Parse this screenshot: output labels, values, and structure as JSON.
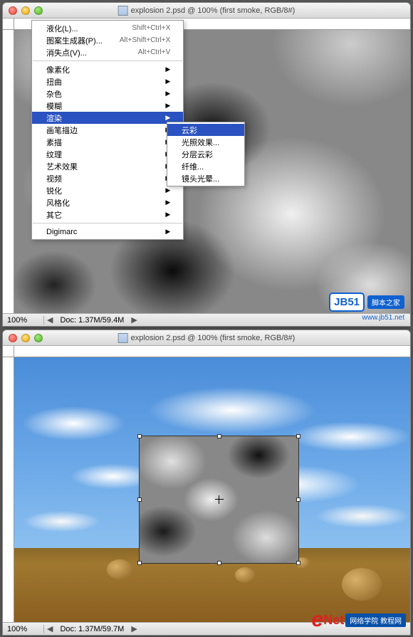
{
  "windows": {
    "top": {
      "title": "explosion 2.psd @ 100% (first smoke, RGB/8#)",
      "zoom": "100%",
      "docinfo": "Doc: 1.37M/59.4M"
    },
    "bottom": {
      "title": "explosion 2.psd @ 100% (first smoke, RGB/8#)",
      "zoom": "100%",
      "docinfo": "Doc: 1.37M/59.7M"
    }
  },
  "menu": {
    "items": [
      {
        "label": "液化(L)...",
        "shortcut": "Shift+Ctrl+X"
      },
      {
        "label": "图案生成器(P)...",
        "shortcut": "Alt+Shift+Ctrl+X"
      },
      {
        "label": "消失点(V)...",
        "shortcut": "Alt+Ctrl+V"
      }
    ],
    "categories": [
      {
        "label": "像素化"
      },
      {
        "label": "扭曲"
      },
      {
        "label": "杂色"
      },
      {
        "label": "模糊"
      },
      {
        "label": "渲染",
        "highlight": true
      },
      {
        "label": "画笔描边"
      },
      {
        "label": "素描"
      },
      {
        "label": "纹理"
      },
      {
        "label": "艺术效果"
      },
      {
        "label": "视频"
      },
      {
        "label": "锐化"
      },
      {
        "label": "风格化"
      },
      {
        "label": "其它"
      }
    ],
    "last": {
      "label": "Digimarc"
    }
  },
  "submenu": {
    "items": [
      {
        "label": "云彩",
        "highlight": true
      },
      {
        "label": "光照效果..."
      },
      {
        "label": "分层云彩"
      },
      {
        "label": "纤维..."
      },
      {
        "label": "镜头光晕..."
      }
    ]
  },
  "watermarks": {
    "jb51": {
      "badge": "JB51",
      "text": "脚本之家",
      "url": "www.jb51.net"
    },
    "enet": {
      "e": "e",
      "net": "Net",
      "text": "网络学院 教程网"
    }
  }
}
